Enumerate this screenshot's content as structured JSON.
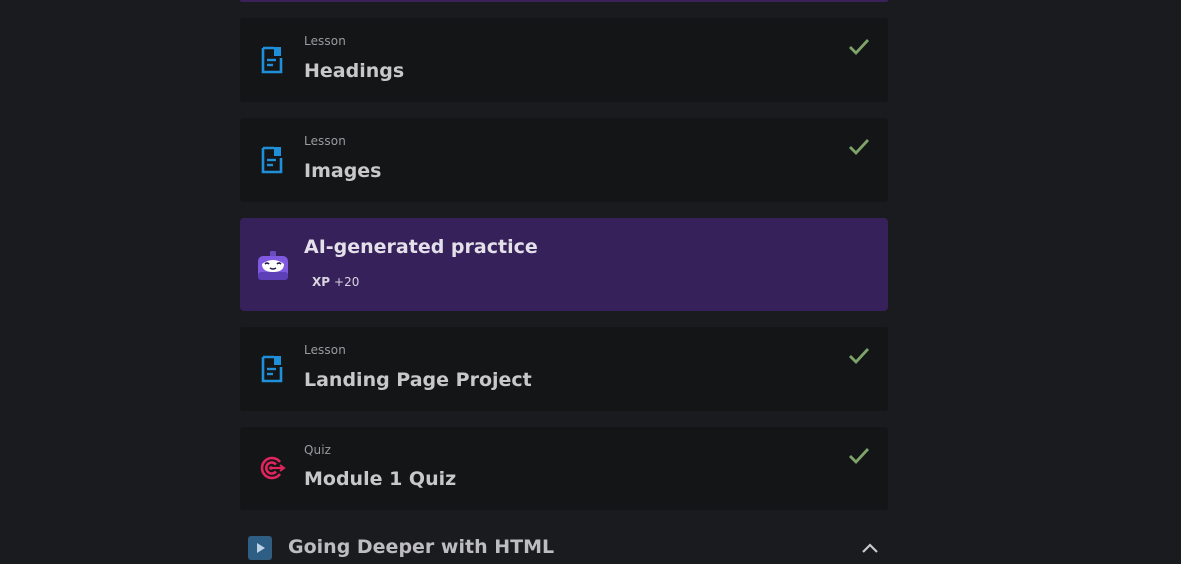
{
  "items": [
    {
      "kind": "Lesson",
      "title": "Headings",
      "completed": true,
      "icon": "document-icon"
    },
    {
      "kind": "Lesson",
      "title": "Images",
      "completed": true,
      "icon": "document-icon"
    },
    {
      "title": "AI-generated practice",
      "xp_label": "XP",
      "xp_value": "+20",
      "icon": "robot-icon"
    },
    {
      "kind": "Lesson",
      "title": "Landing Page Project",
      "completed": true,
      "icon": "document-icon"
    },
    {
      "kind": "Quiz",
      "title": "Module 1 Quiz",
      "completed": true,
      "icon": "target-icon"
    }
  ],
  "module": {
    "title": "Going Deeper with HTML",
    "icon": "play-icon",
    "expanded": true
  },
  "colors": {
    "background": "#1a1b1e",
    "card": "#141516",
    "ai_card": "#36215a",
    "lesson_icon": "#1e8fd8",
    "quiz_icon": "#e0245e",
    "check": "#7ea36b",
    "module_icon": "#2f5e85"
  }
}
